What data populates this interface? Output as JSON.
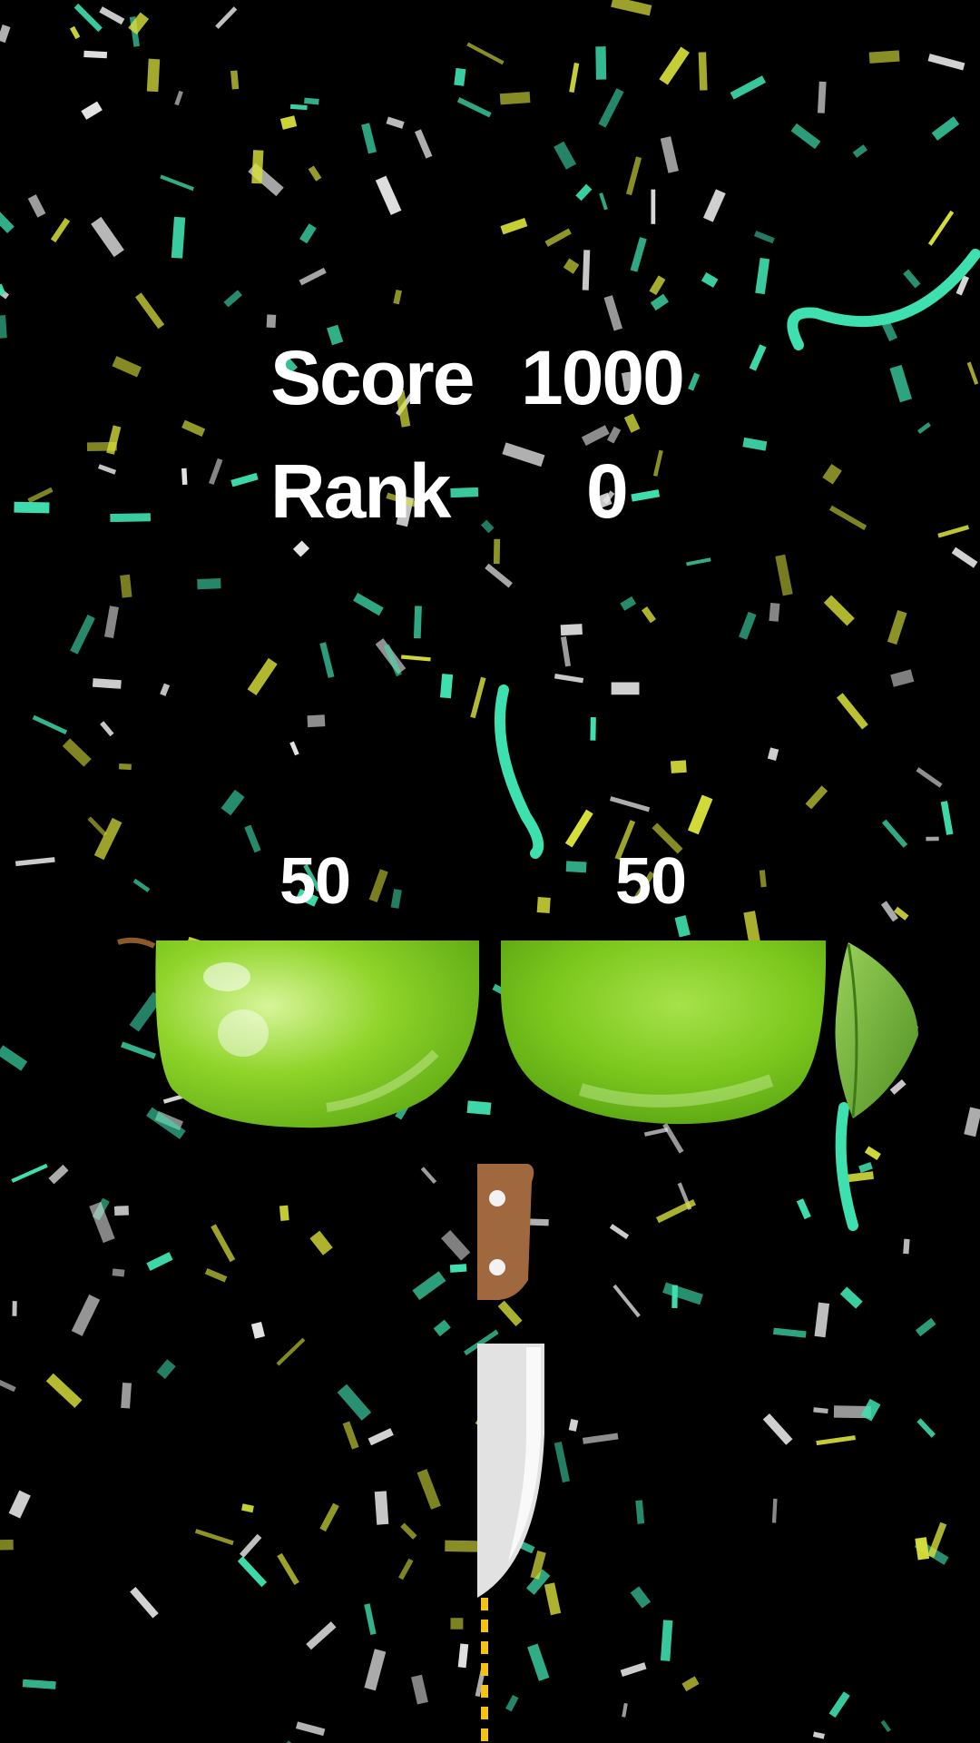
{
  "hud": {
    "score_label": "Score",
    "score_value": "1000",
    "rank_label": "Rank",
    "rank_value": "0"
  },
  "slices": {
    "left_value": "50",
    "right_value": "50"
  },
  "colors": {
    "background": "#000000",
    "text": "#ffffff",
    "apple_green": "#7fd01c",
    "confetti_teal": "#3fe0b0",
    "confetti_yellow": "#d8e03a",
    "confetti_white": "#e6e6e6",
    "knife_handle": "#a0683e",
    "knife_blade": "#e2e2e2",
    "guide_line": "#f2c21a"
  },
  "icons": [
    "apple-half-left-icon",
    "apple-half-right-icon",
    "leaf-icon",
    "knife-icon"
  ]
}
